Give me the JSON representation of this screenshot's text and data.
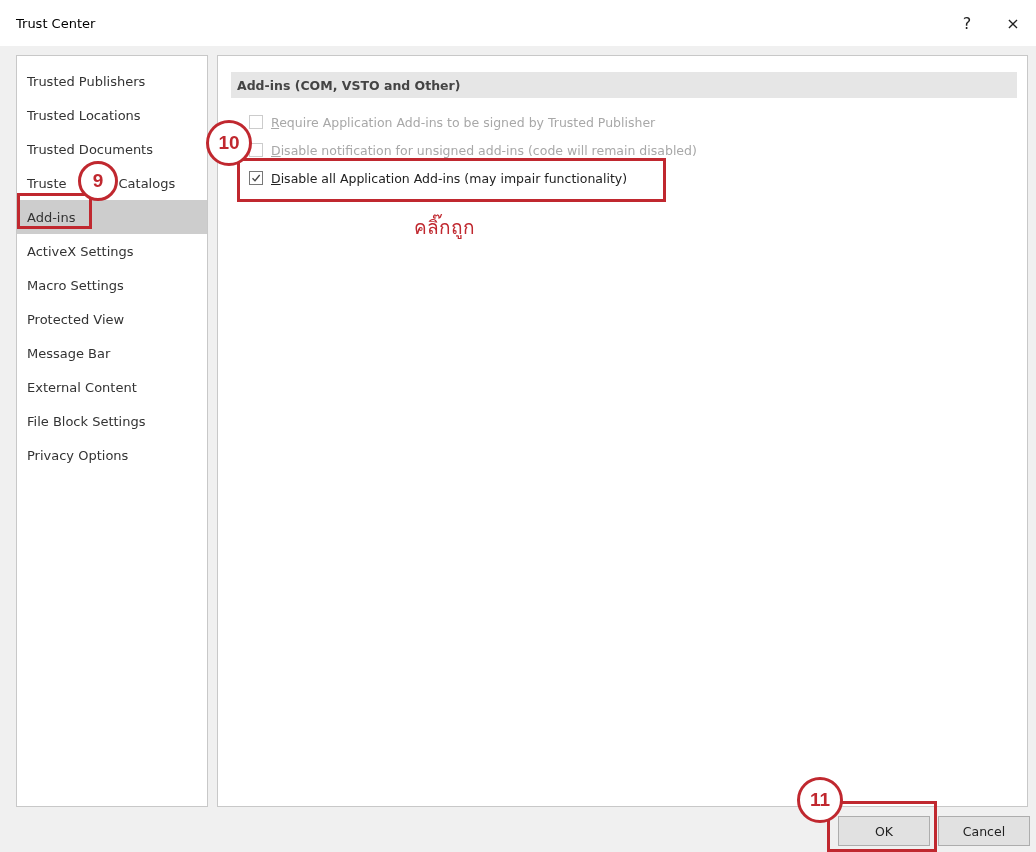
{
  "window": {
    "title": "Trust Center",
    "help": "?",
    "close": "×"
  },
  "sidebar": {
    "items": [
      {
        "label": "Trusted Publishers",
        "selected": false
      },
      {
        "label": "Trusted Locations",
        "selected": false
      },
      {
        "label": "Trusted Documents",
        "selected": false
      },
      {
        "label": "Truste",
        "label_end": "Catalogs",
        "selected": false
      },
      {
        "label": "Add-ins",
        "selected": true
      },
      {
        "label": "ActiveX Settings",
        "selected": false
      },
      {
        "label": "Macro Settings",
        "selected": false
      },
      {
        "label": "Protected View",
        "selected": false
      },
      {
        "label": "Message Bar",
        "selected": false
      },
      {
        "label": "External Content",
        "selected": false
      },
      {
        "label": "File Block Settings",
        "selected": false
      },
      {
        "label": "Privacy Options",
        "selected": false
      }
    ]
  },
  "section": {
    "title": "Add-ins (COM, VSTO and Other)",
    "options": [
      {
        "label": "Require Application Add-ins to be signed by Trusted Publisher",
        "checked": false,
        "disabled": true
      },
      {
        "label": "Disable notification for unsigned add-ins (code will remain disabled)",
        "checked": false,
        "disabled": true
      },
      {
        "label": "Disable all Application Add-ins (may impair functionality)",
        "checked": true,
        "disabled": false
      }
    ]
  },
  "annotations": {
    "note": "คลิ๊กถูก",
    "steps": [
      {
        "number": "9"
      },
      {
        "number": "10"
      },
      {
        "number": "11"
      }
    ]
  },
  "buttons": [
    "OK",
    "Cancel"
  ]
}
